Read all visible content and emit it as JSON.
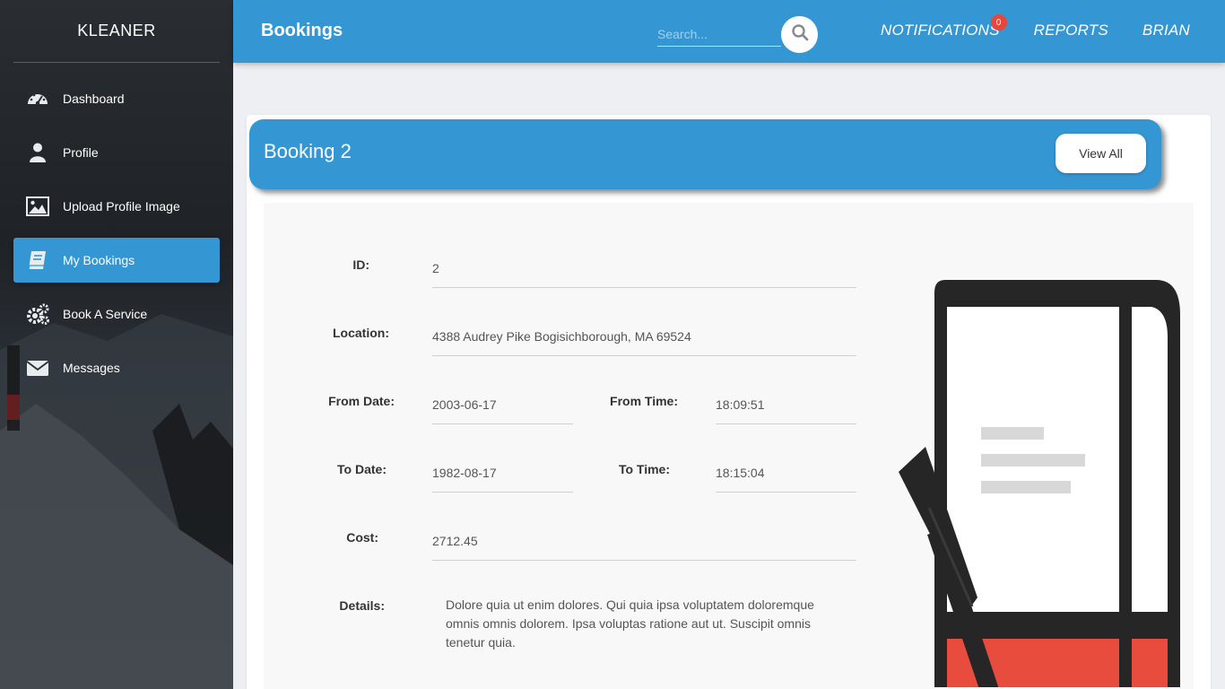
{
  "app": {
    "brand": "KLEANER"
  },
  "sidebar": {
    "items": [
      {
        "label": "Dashboard",
        "icon": "dashboard-icon",
        "active": false
      },
      {
        "label": "Profile",
        "icon": "user-icon",
        "active": false
      },
      {
        "label": "Upload Profile Image",
        "icon": "image-icon",
        "active": false
      },
      {
        "label": "My Bookings",
        "icon": "book-icon",
        "active": true
      },
      {
        "label": "Book A Service",
        "icon": "gears-icon",
        "active": false
      },
      {
        "label": "Messages",
        "icon": "envelope-icon",
        "active": false
      }
    ]
  },
  "header": {
    "title": "Bookings",
    "search": {
      "placeholder": "Search...",
      "value": ""
    },
    "links": {
      "notifications": "NOTIFICATIONS",
      "reports": "REPORTS",
      "user": "BRIAN"
    },
    "notification_count": "0"
  },
  "booking": {
    "title": "Booking 2",
    "view_all_label": "View All",
    "labels": {
      "id": "ID:",
      "location": "Location:",
      "from_date": "From Date:",
      "from_time": "From Time:",
      "to_date": "To Date:",
      "to_time": "To Time:",
      "cost": "Cost:",
      "details": "Details:"
    },
    "values": {
      "id": "2",
      "location": "4388 Audrey Pike Bogisichborough, MA 69524",
      "from_date": "2003-06-17",
      "from_time": "18:09:51",
      "to_date": "1982-08-17",
      "to_time": "18:15:04",
      "cost": "2712.45",
      "details": "Dolore quia ut enim dolores. Qui quia ipsa voluptatem doloremque omnis omnis dolorem. Ipsa voluptas ratione aut ut. Suscipit omnis tenetur quia."
    }
  },
  "colors": {
    "accent": "#3496d3",
    "badge": "#e8463a",
    "illustration_red": "#e84c3d",
    "illustration_dark": "#262626"
  }
}
